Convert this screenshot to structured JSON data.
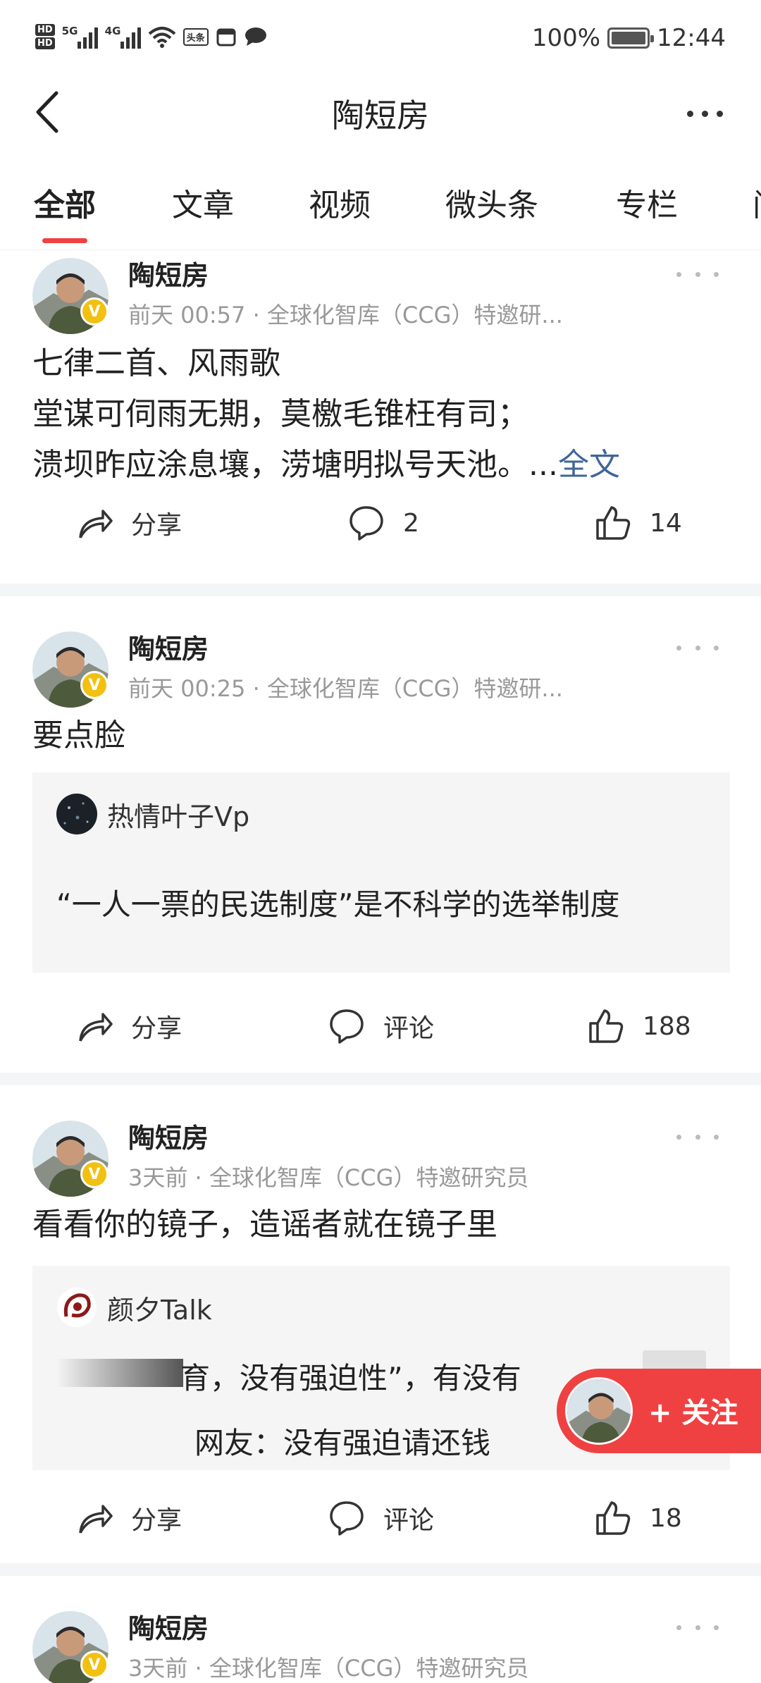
{
  "status_bar": {
    "hd_top": "HD",
    "hd_bottom": "HD",
    "signal1_label": "5G",
    "signal2_label": "4G",
    "news_badge": "头条",
    "battery_text": "100%",
    "time": "12:44"
  },
  "header": {
    "title": "陶短房"
  },
  "tabs": [
    "全部",
    "文章",
    "视频",
    "微头条",
    "专栏",
    "问"
  ],
  "posts": [
    {
      "author": "陶短房",
      "meta": "前天  00:57 · 全球化智库（CCG）特邀研...",
      "content_lines": [
        "七律二首、风雨歌",
        "堂谋可伺雨无期，莫檄毛锥枉有司；",
        "溃坝昨应涂息壤，涝塘明拟号天池。..."
      ],
      "full_text_link": "全文",
      "share": "分享",
      "comments": "2",
      "likes": "14"
    },
    {
      "author": "陶短房",
      "meta": "前天  00:25 · 全球化智库（CCG）特邀研...",
      "content": "要点脸",
      "quote_author": "热情叶子Vp",
      "quote_text": "“一人一票的民选制度”是不科学的选举制度",
      "share": "分享",
      "comments": "评论",
      "likes": "188"
    },
    {
      "author": "陶短房",
      "meta": "3天前 · 全球化智库（CCG）特邀研究员",
      "content": "看看你的镜子，造谣者就在镜子里",
      "quote_author": "颜夕Talk",
      "quote_line1": "育，没有强迫性”，有没有",
      "quote_line2": "网友：没有强迫请还钱",
      "share": "分享",
      "comments": "评论",
      "likes": "18"
    },
    {
      "author": "陶短房",
      "meta": "3天前 · 全球化智库（CCG）特邀研究员"
    }
  ],
  "follow_button": {
    "label": "+ 关注"
  },
  "colors": {
    "accent": "#f04142",
    "badge": "#f2c010",
    "link": "#406599"
  }
}
